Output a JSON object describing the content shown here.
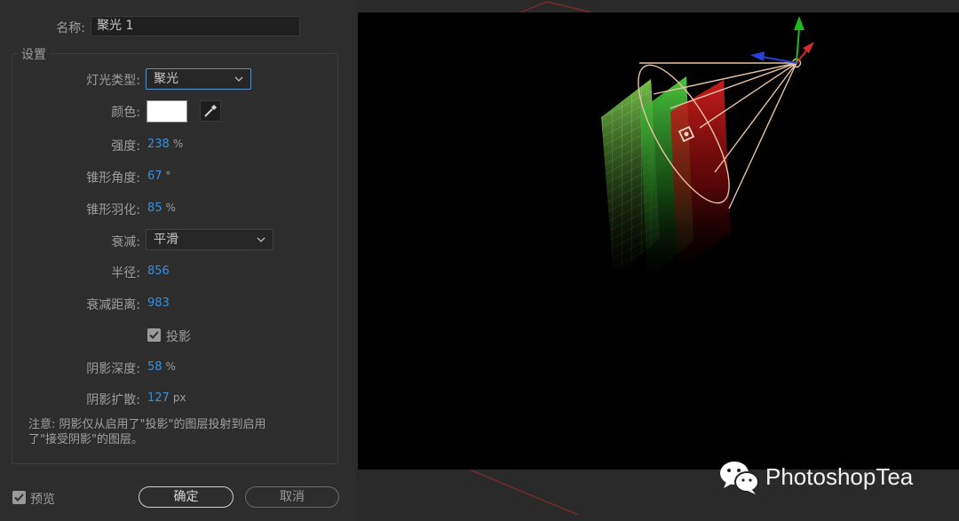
{
  "dialog": {
    "name_label": "名称:",
    "name_value": "聚光 1",
    "settings_title": "设置",
    "light_type": {
      "label": "灯光类型:",
      "value": "聚光"
    },
    "color": {
      "label": "颜色:",
      "value": "#ffffff"
    },
    "intensity": {
      "label": "强度:",
      "value": "238",
      "unit": "%"
    },
    "cone_angle": {
      "label": "锥形角度:",
      "value": "67",
      "unit": "°"
    },
    "cone_feather": {
      "label": "锥形羽化:",
      "value": "85",
      "unit": "%"
    },
    "falloff": {
      "label": "衰减:",
      "value": "平滑"
    },
    "radius": {
      "label": "半径:",
      "value": "856"
    },
    "falloff_distance": {
      "label": "衰减距离:",
      "value": "983"
    },
    "casts_shadows": {
      "label": "投影",
      "checked": true
    },
    "shadow_darkness": {
      "label": "阴影深度:",
      "value": "58",
      "unit": "%"
    },
    "shadow_diffusion": {
      "label": "阴影扩散:",
      "value": "127",
      "unit": "px"
    },
    "note_line1": "注意: 阴影仅从启用了\"投影\"的图层投射到启用",
    "note_line2": "了\"接受阴影\"的图层。",
    "preview": {
      "label": "预览",
      "checked": true
    },
    "ok_label": "确定",
    "cancel_label": "取消"
  },
  "viewport": {
    "layers": [
      "grid",
      "green",
      "red"
    ],
    "colors": {
      "background": "#000000",
      "cone": "#e7c3a6",
      "x_axis": "#d42a2a",
      "y_axis": "#1fb81f",
      "z_axis": "#2b3fd6"
    }
  },
  "watermark": {
    "icon": "wechat-icon",
    "text": "PhotoshopTea"
  }
}
